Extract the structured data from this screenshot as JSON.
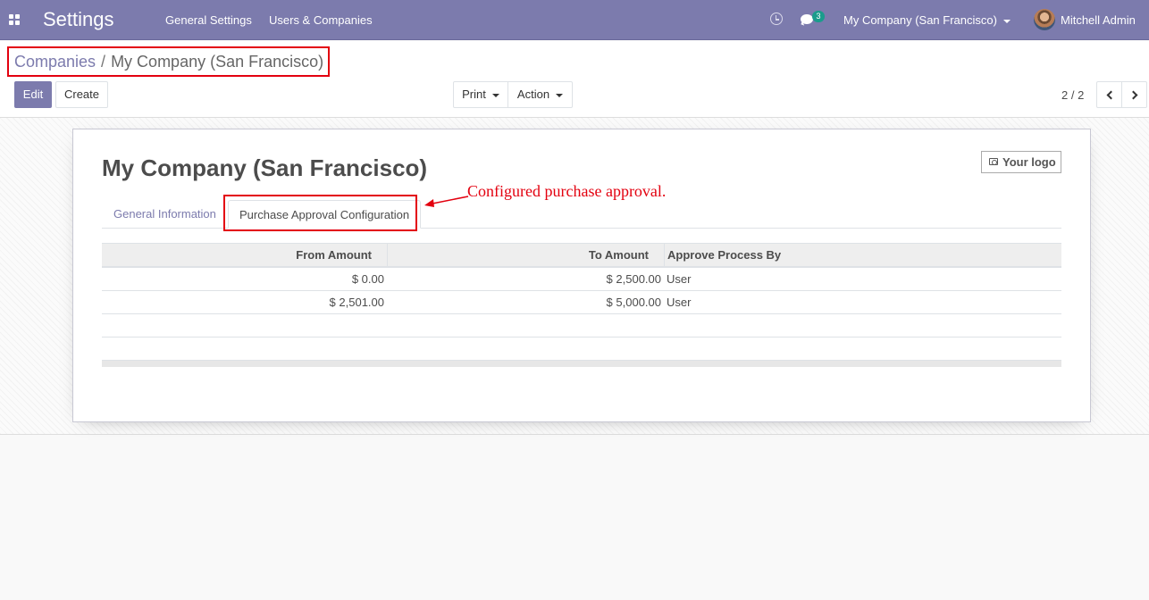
{
  "navbar": {
    "app_title": "Settings",
    "menu": [
      "General Settings",
      "Users & Companies"
    ],
    "messages_count": "3",
    "company": "My Company (San Francisco)",
    "user": "Mitchell Admin"
  },
  "breadcrumb": {
    "parent": "Companies",
    "separator": "/",
    "current": "My Company (San Francisco)"
  },
  "buttons": {
    "edit": "Edit",
    "create": "Create",
    "print": "Print",
    "action": "Action"
  },
  "pager": {
    "value": "2 / 2"
  },
  "form": {
    "title": "My Company (San Francisco)",
    "logo_label": "Your logo",
    "tabs": [
      "General Information",
      "Purchase Approval Configuration"
    ],
    "active_tab": "Purchase Approval Configuration",
    "annotation": "Configured purchase approval.",
    "table": {
      "columns": [
        "From Amount",
        "To Amount",
        "Approve Process By"
      ],
      "rows": [
        {
          "from": "$ 0.00",
          "to": "$ 2,500.00",
          "by": "User"
        },
        {
          "from": "$ 2,501.00",
          "to": "$ 5,000.00",
          "by": "User"
        }
      ]
    }
  },
  "colors": {
    "brand": "#7c7bad",
    "annotation_red": "#e3000f",
    "badge": "#1a9c8c"
  }
}
